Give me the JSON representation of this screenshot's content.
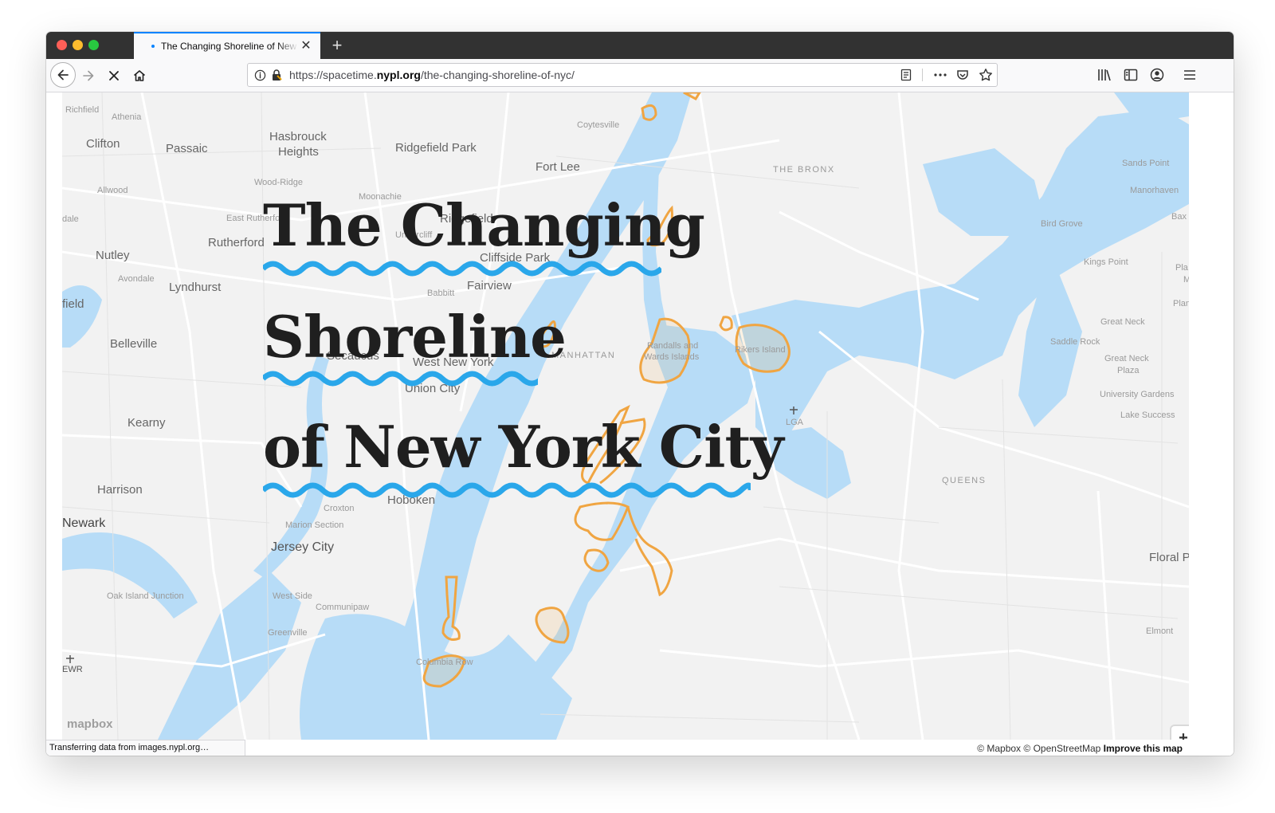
{
  "browser": {
    "tab_title": "The Changing Shoreline of New York City",
    "tab_close_glyph": "✕",
    "newtab_glyph": "+",
    "url_prefix": "https://spacetime.",
    "url_host": "nypl.org",
    "url_path": "/the-changing-shoreline-of-nyc/",
    "status_text": "Transferring data from images.nypl.org…"
  },
  "hero": {
    "line1": "The Changing",
    "line2": "Shoreline",
    "line3": "of New York City"
  },
  "map": {
    "attribution_mapbox": "© Mapbox",
    "attribution_osm": "© OpenStreetMap",
    "improve": "Improve this map",
    "zoom_in": "+",
    "zoom_out": "−",
    "logo": "mapbox",
    "places": {
      "richfield": "Richfield",
      "athenia": "Athenia",
      "clifton": "Clifton",
      "passaic": "Passaic",
      "hasbrouck": "Hasbrouck",
      "heights": "Heights",
      "ridgefield_park": "Ridgefield Park",
      "coytesville": "Coytesville",
      "fort_lee": "Fort Lee",
      "the_bronx": "THE BRONX",
      "sands_point": "Sands Point",
      "manorhaven": "Manorhaven",
      "wood_ridge": "Wood-Ridge",
      "allwood": "Allwood",
      "moonachie": "Moonachie",
      "east_rutherford": "East Rutherford",
      "ridgefield": "Ridgefield",
      "rutherford": "Rutherford",
      "undercliff": "Undercliff",
      "cliffside_park": "Cliffside Park",
      "bird_grove": "Bird Grove",
      "kings_point": "Kings Point",
      "nutley": "Nutley",
      "avondale": "Avondale",
      "lyndhurst": "Lyndhurst",
      "fairview": "Fairview",
      "babbitt": "Babbitt",
      "field": "field",
      "dale": "dale",
      "plandome": "Plando",
      "great_neck": "Great Neck",
      "belleville": "Belleville",
      "secaucus": "Secaucus",
      "west_new_york": "West New York",
      "manhattan": "MANHATTAN",
      "randalls": "Randalls and",
      "wards": "Wards Islands",
      "rikers": "Rikers Island",
      "saddle_rock": "Saddle Rock",
      "great_neck_plaza_1": "Great Neck",
      "great_neck_plaza_2": "Plaza",
      "union_city": "Union City",
      "university_gardens": "University Gardens",
      "kearny": "Kearny",
      "lga": "LGA",
      "lake_success": "Lake Success",
      "harrison": "Harrison",
      "queens": "QUEENS",
      "hoboken": "Hoboken",
      "newark": "Newark",
      "croxton": "Croxton",
      "marion_section": "Marion Section",
      "jersey_city": "Jersey City",
      "floral_park": "Floral P",
      "oak_island": "Oak Island Junction",
      "west_side": "West Side",
      "communipaw": "Communipaw",
      "greenville": "Greenville",
      "elmont": "Elmont",
      "ewr": "EWR",
      "columbia_row": "Columbia Row",
      "bax": "Bax",
      "pla": "Pla",
      "m": "M"
    }
  },
  "colors": {
    "water": "#b7dcf7",
    "land": "#f2f2f2",
    "shoreline": "#f0a542",
    "wave": "#2aa7ea",
    "title_text": "#1f1f1f"
  },
  "icons": {
    "back": "arrow-left-icon",
    "forward": "arrow-right-icon",
    "stop": "close-icon",
    "home": "home-icon",
    "info": "info-icon",
    "lock": "lock-icon",
    "reader": "reader-view-icon",
    "more": "more-icon",
    "pocket": "pocket-icon",
    "star": "bookmark-star-icon",
    "library": "library-icon",
    "sidebar": "sidebar-icon",
    "account": "account-icon",
    "menu": "hamburger-menu-icon"
  }
}
